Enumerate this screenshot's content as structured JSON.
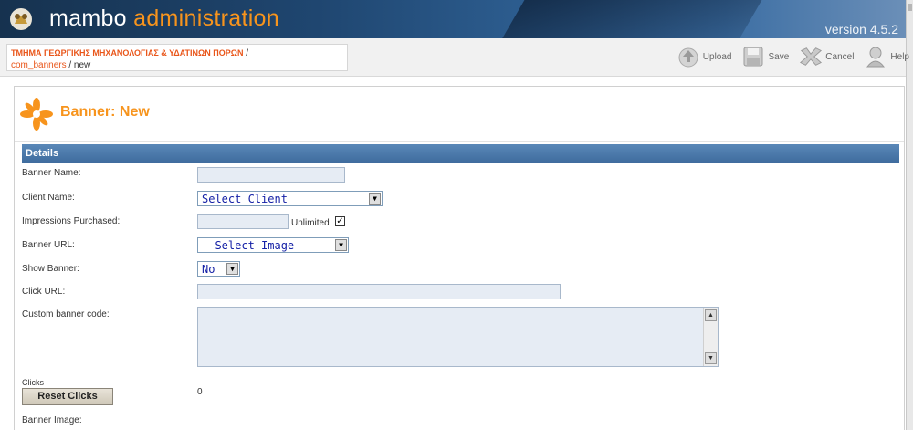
{
  "header": {
    "brand_prefix": "mambo",
    "brand_suffix": "administration",
    "version": "version 4.5.2"
  },
  "breadcrumb": {
    "site": "ΤΜΗΜΑ ΓΕΩΡΓΙΚΗΣ ΜΗΧΑΝΟΛΟΓΙΑΣ & ΥΔΑΤΙΝΩΝ ΠΟΡΩΝ",
    "separator": " /",
    "component": "com_banners",
    "current": " / new"
  },
  "toolbar": {
    "upload_label": "Upload",
    "save_label": "Save",
    "cancel_label": "Cancel",
    "help_label": "Help"
  },
  "page": {
    "title": "Banner: New",
    "section": "Details"
  },
  "form": {
    "banner_name_label": "Banner Name:",
    "banner_name_value": "",
    "client_name_label": "Client Name:",
    "client_name_selected": "Select Client",
    "impressions_label": "Impressions Purchased:",
    "impressions_value": "",
    "unlimited_label": "Unlimited",
    "unlimited_checked": true,
    "banner_url_label": "Banner URL:",
    "banner_url_selected": "- Select Image -",
    "show_banner_label": "Show Banner:",
    "show_banner_selected": "No",
    "click_url_label": "Click URL:",
    "click_url_value": "",
    "custom_code_label": "Custom banner code:",
    "custom_code_value": "",
    "clicks_label": "Clicks",
    "clicks_value": "0",
    "reset_clicks_label": "Reset Clicks",
    "banner_image_label": "Banner Image:"
  },
  "colors": {
    "accent_orange": "#f7941d",
    "header_blue": "#1f4670",
    "section_blue": "#3f6c9e",
    "link_orange": "#e9561a"
  }
}
